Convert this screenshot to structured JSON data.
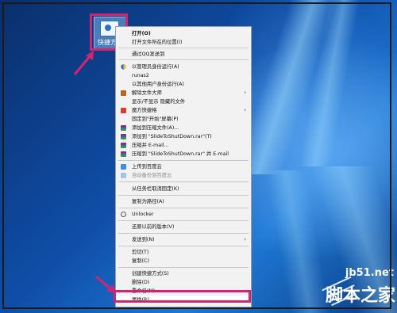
{
  "desktop": {
    "icon_label": "快捷方式",
    "colors": {
      "highlight": "#d42471",
      "menu_bg": "#f2f2f2"
    }
  },
  "menu": {
    "items": [
      {
        "label": "打开(O)",
        "bold": true,
        "icon": "",
        "submenu": false
      },
      {
        "label": "打开文件所在的位置(I)",
        "icon": "",
        "submenu": false
      },
      {
        "label": "通过QQ发送到",
        "icon": "",
        "submenu": false
      },
      {
        "label": "以管理员身份运行(A)",
        "icon": "shield-icon",
        "submenu": false
      },
      {
        "label": "runas2",
        "icon": "",
        "submenu": false
      },
      {
        "label": "以其他用户身份运行(A)",
        "icon": "",
        "submenu": false
      },
      {
        "label": "解除文件大师",
        "icon": "file-master-icon",
        "submenu": true
      },
      {
        "label": "显示/不显示 隐藏的文件",
        "icon": "",
        "submenu": false
      },
      {
        "label": "魔方快捷格",
        "icon": "cube-icon",
        "submenu": true
      },
      {
        "label": "固定到\"开始\"屏幕(P)",
        "icon": "",
        "submenu": false
      },
      {
        "label": "添加到压缩文件(A)...",
        "icon": "winrar-icon",
        "submenu": false
      },
      {
        "label": "添加到 \"SlideToShutDown.rar\"(T)",
        "icon": "winrar-icon",
        "submenu": false
      },
      {
        "label": "压缩并 E-mail...",
        "icon": "winrar-icon",
        "submenu": false
      },
      {
        "label": "压缩到 \"SlideToShutDown.rar\" 并 E-mail",
        "icon": "winrar-icon",
        "submenu": false
      },
      {
        "label": "上传到百度云",
        "icon": "cloud-icon",
        "submenu": false
      },
      {
        "label": "自动备份到百度云",
        "icon": "cloud-icon",
        "submenu": false,
        "disabled": true
      },
      {
        "label": "从任务栏取消固定(K)",
        "icon": "",
        "submenu": false
      },
      {
        "label": "复制为路径(A)",
        "icon": "",
        "submenu": false
      },
      {
        "label": "Unlocker",
        "icon": "unlocker-icon",
        "submenu": false
      },
      {
        "label": "还原以前的版本(V)",
        "icon": "",
        "submenu": false
      },
      {
        "label": "发送到(N)",
        "icon": "",
        "submenu": true
      },
      {
        "label": "剪切(T)",
        "icon": "",
        "submenu": false
      },
      {
        "label": "复制(C)",
        "icon": "",
        "submenu": false
      },
      {
        "label": "创建快捷方式(S)",
        "icon": "",
        "submenu": false
      },
      {
        "label": "删除(D)",
        "icon": "",
        "submenu": false
      },
      {
        "label": "重命名(M)",
        "icon": "",
        "submenu": false
      },
      {
        "label": "属性(R)",
        "icon": "",
        "submenu": false,
        "highlighted": true
      }
    ]
  },
  "watermark": {
    "url": "jb51.net",
    "text": "脚本之家"
  }
}
